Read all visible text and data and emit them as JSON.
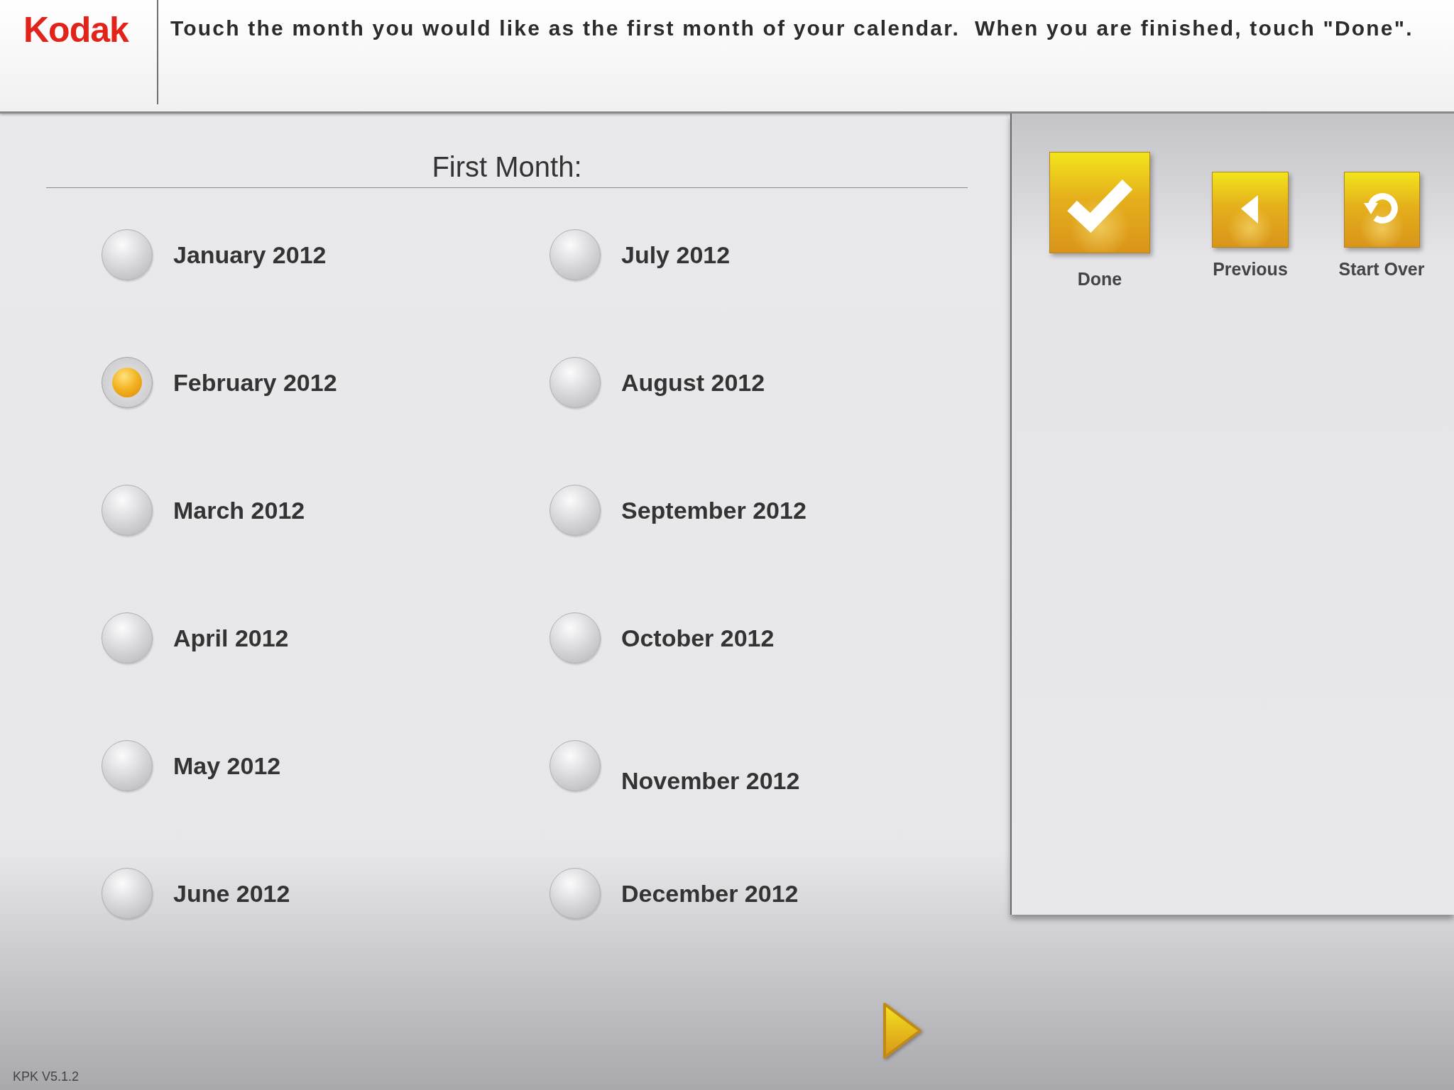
{
  "header": {
    "logo": "Kodak",
    "instruction": "Touch the month you would like as the first month of your calendar.  When you are finished, touch \"Done\"."
  },
  "month_picker": {
    "title": "First Month:",
    "months": [
      {
        "label": "January 2012",
        "selected": false
      },
      {
        "label": "February 2012",
        "selected": true
      },
      {
        "label": "March 2012",
        "selected": false
      },
      {
        "label": "April 2012",
        "selected": false
      },
      {
        "label": "May 2012",
        "selected": false
      },
      {
        "label": "June 2012",
        "selected": false
      },
      {
        "label": "July 2012",
        "selected": false
      },
      {
        "label": "August 2012",
        "selected": false
      },
      {
        "label": "September 2012",
        "selected": false
      },
      {
        "label": "October 2012",
        "selected": false
      },
      {
        "label": "November 2012",
        "selected": false
      },
      {
        "label": "December 2012",
        "selected": false
      }
    ]
  },
  "actions": [
    {
      "kind": "done",
      "label": "Done"
    },
    {
      "kind": "previous",
      "label": "Previous"
    },
    {
      "kind": "start_over",
      "label": "Start Over"
    }
  ],
  "version": "KPK V5.1.2"
}
